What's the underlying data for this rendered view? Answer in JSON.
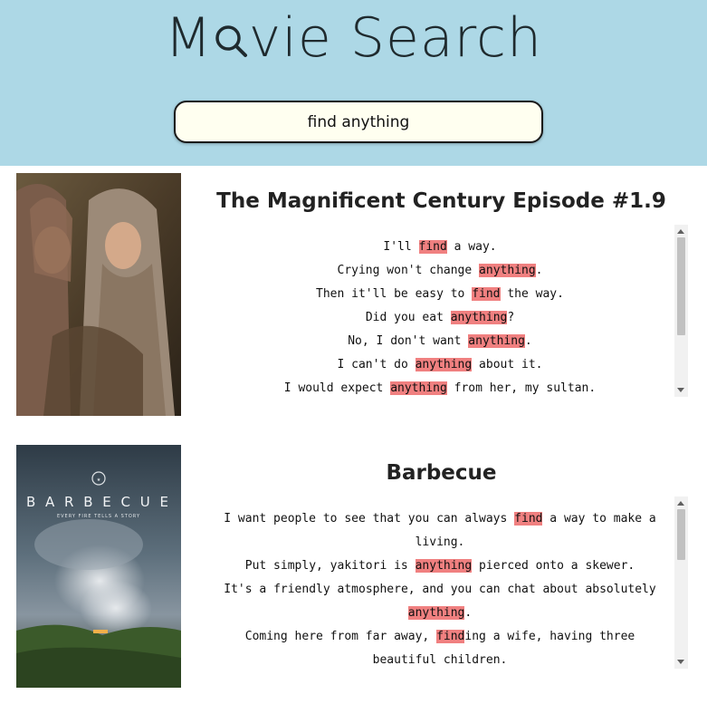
{
  "header": {
    "title_prefix": "M",
    "title_suffix": "vie Search",
    "title_icon": "magnifier-o-icon",
    "background": "#add8e6"
  },
  "search": {
    "value": "find anything",
    "placeholder": ""
  },
  "highlight_color": "#f08080",
  "results": [
    {
      "title": "The Magnificent Century Episode #1.9",
      "lines": [
        [
          {
            "t": "I'll "
          },
          {
            "t": "find",
            "hl": true
          },
          {
            "t": " a way."
          }
        ],
        [
          {
            "t": "Crying won't change "
          },
          {
            "t": "anything",
            "hl": true
          },
          {
            "t": "."
          }
        ],
        [
          {
            "t": "Then it'll be easy to "
          },
          {
            "t": "find",
            "hl": true
          },
          {
            "t": " the way."
          }
        ],
        [
          {
            "t": "Did you eat "
          },
          {
            "t": "anything",
            "hl": true
          },
          {
            "t": "?"
          }
        ],
        [
          {
            "t": "No, I don't want "
          },
          {
            "t": "anything",
            "hl": true
          },
          {
            "t": "."
          }
        ],
        [
          {
            "t": "I can't do "
          },
          {
            "t": "anything",
            "hl": true
          },
          {
            "t": " about it."
          }
        ],
        [
          {
            "t": "I would expect "
          },
          {
            "t": "anything",
            "hl": true
          },
          {
            "t": " from her, my sultan."
          }
        ]
      ]
    },
    {
      "title": "Barbecue",
      "poster_text": "B A R B E C U E",
      "poster_tagline": "EVERY FIRE TELLS A STORY",
      "lines": [
        [
          {
            "t": "I want people to see that you can always "
          },
          {
            "t": "find",
            "hl": true
          },
          {
            "t": " a way to make a"
          }
        ],
        [
          {
            "t": "living."
          }
        ],
        [
          {
            "t": "Put simply, yakitori is "
          },
          {
            "t": "anything",
            "hl": true
          },
          {
            "t": " pierced onto a skewer."
          }
        ],
        [
          {
            "t": "It's a friendly atmosphere, and you can chat about absolutely"
          }
        ],
        [
          {
            "t": "anything",
            "hl": true
          },
          {
            "t": "."
          }
        ],
        [
          {
            "t": "Coming here from far away, "
          },
          {
            "t": "find",
            "hl": true
          },
          {
            "t": "ing a wife, having three"
          }
        ],
        [
          {
            "t": "beautiful children."
          }
        ]
      ]
    }
  ]
}
